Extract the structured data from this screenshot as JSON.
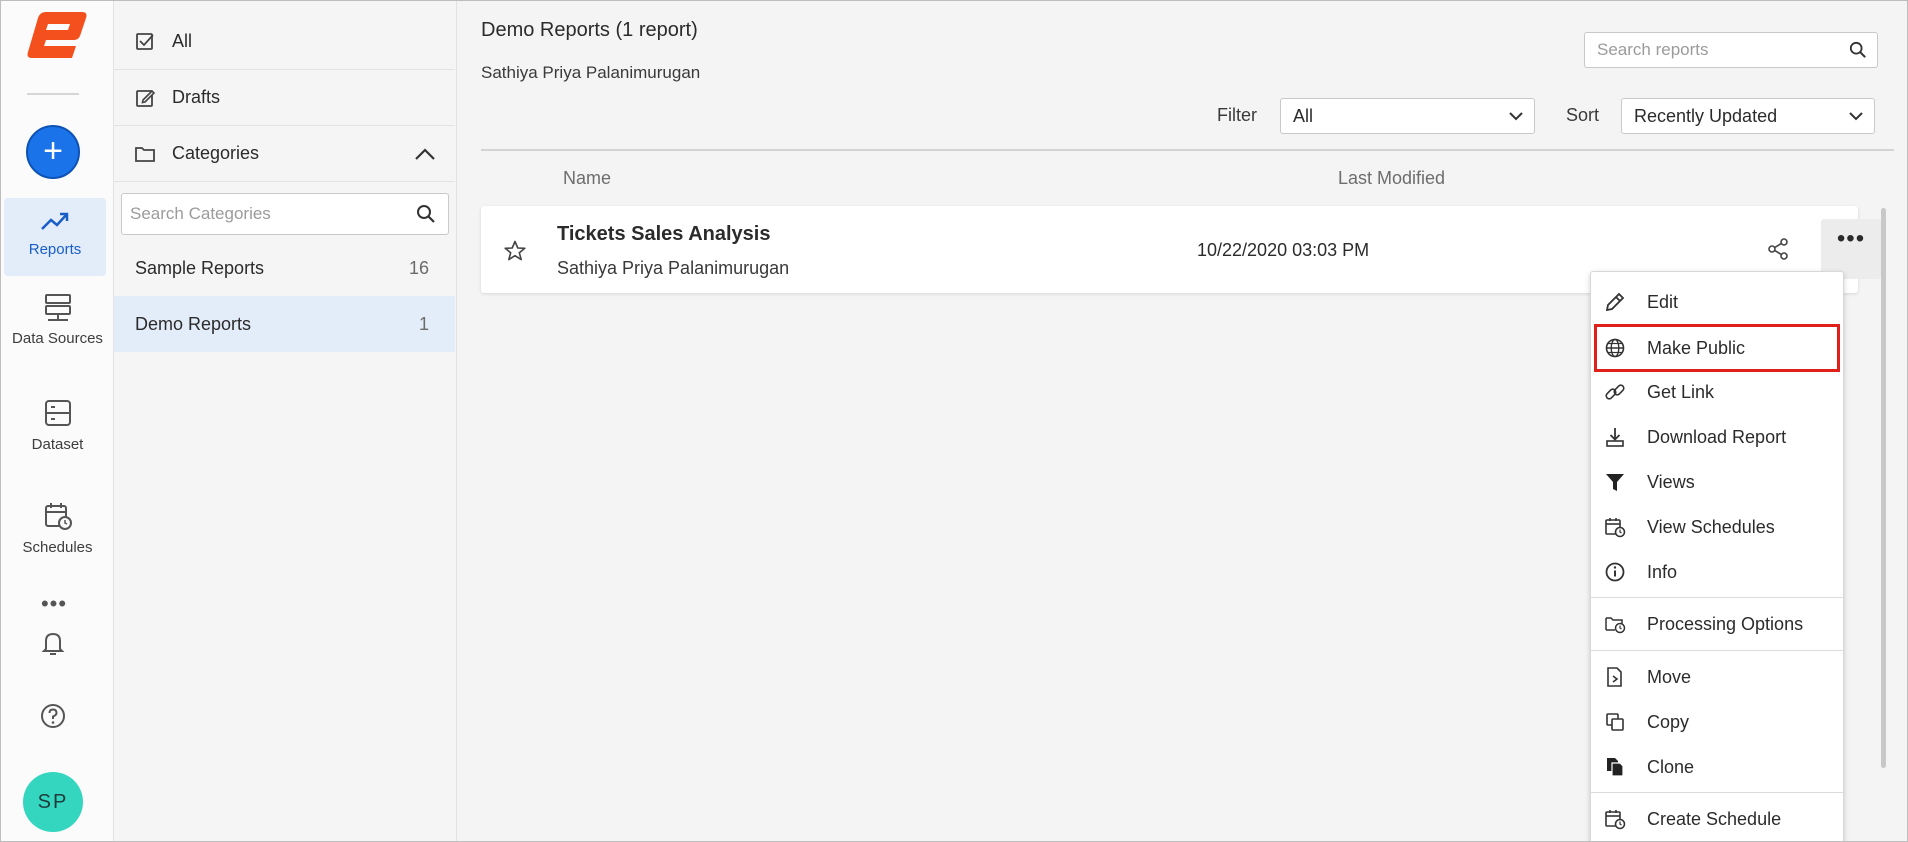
{
  "rail": {
    "add_label": "+",
    "items": [
      {
        "label": "Reports"
      },
      {
        "label": "Data Sources"
      },
      {
        "label": "Dataset"
      },
      {
        "label": "Schedules"
      }
    ],
    "more_label": "•••",
    "avatar_initials": "SP"
  },
  "categories": {
    "all_label": "All",
    "drafts_label": "Drafts",
    "categories_label": "Categories",
    "search_placeholder": "Search Categories",
    "items": [
      {
        "label": "Sample Reports",
        "count": "16"
      },
      {
        "label": "Demo Reports",
        "count": "1"
      }
    ]
  },
  "main": {
    "title": "Demo Reports (1 report)",
    "owner": "Sathiya Priya Palanimurugan",
    "search_placeholder": "Search reports",
    "filter_label": "Filter",
    "filter_value": "All",
    "sort_label": "Sort",
    "sort_value": "Recently Updated",
    "col_name": "Name",
    "col_modified": "Last Modified",
    "report": {
      "name": "Tickets Sales Analysis",
      "owner": "Sathiya Priya Palanimurugan",
      "modified": "10/22/2020 03:03 PM"
    },
    "more_label": "•••"
  },
  "menu": {
    "items": [
      {
        "label": "Edit",
        "icon": "pencil-icon"
      },
      {
        "label": "Make Public",
        "icon": "globe-icon"
      },
      {
        "label": "Get Link",
        "icon": "link-icon"
      },
      {
        "label": "Download Report",
        "icon": "download-icon"
      },
      {
        "label": "Views",
        "icon": "filter-icon"
      },
      {
        "label": "View Schedules",
        "icon": "calendar-clock-icon"
      },
      {
        "label": "Info",
        "icon": "info-icon"
      },
      {
        "label": "Processing Options",
        "icon": "folder-clock-icon"
      },
      {
        "label": "Move",
        "icon": "move-icon"
      },
      {
        "label": "Copy",
        "icon": "copy-icon"
      },
      {
        "label": "Clone",
        "icon": "clone-icon"
      },
      {
        "label": "Create Schedule",
        "icon": "calendar-add-icon"
      }
    ]
  },
  "colors": {
    "accent": "#1a73e8",
    "logo": "#f3501d",
    "selected_bg": "#e3ecf9",
    "highlight_border": "#e0201b",
    "avatar": "#34d6c0"
  }
}
